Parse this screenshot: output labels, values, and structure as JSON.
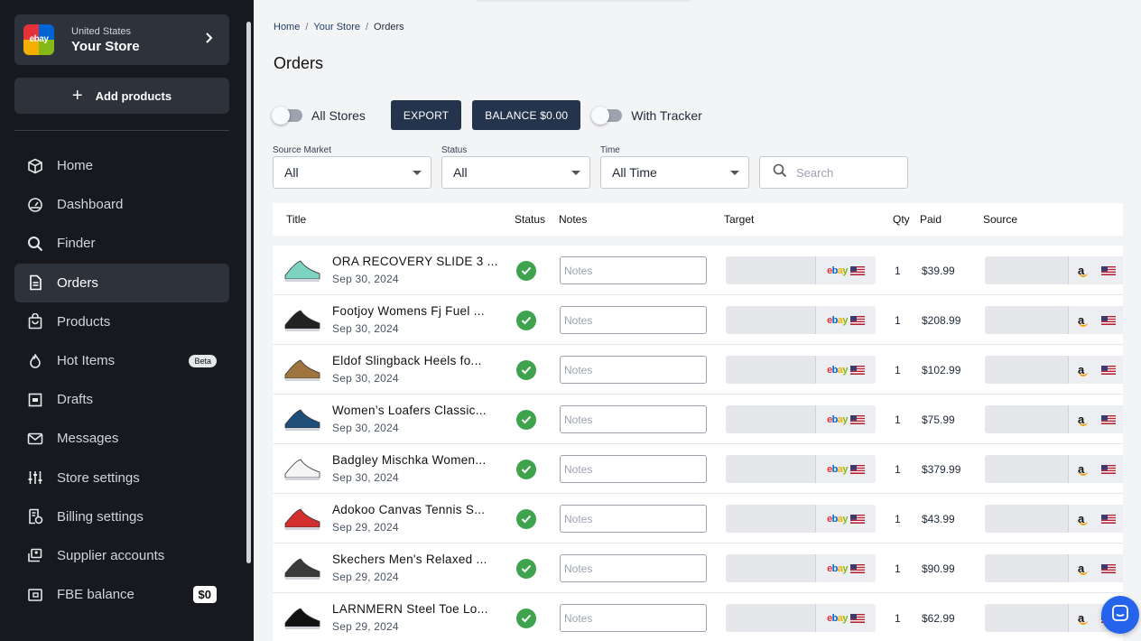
{
  "store": {
    "country": "United States",
    "name": "Your Store",
    "logo_text": "ebay"
  },
  "sidebar": {
    "add_products": "Add products",
    "items": [
      {
        "label": "Home",
        "icon": "cube-icon"
      },
      {
        "label": "Dashboard",
        "icon": "gauge-icon"
      },
      {
        "label": "Finder",
        "icon": "search-icon"
      },
      {
        "label": "Orders",
        "icon": "document-icon",
        "active": true
      },
      {
        "label": "Products",
        "icon": "bag-icon"
      },
      {
        "label": "Hot Items",
        "icon": "flame-icon",
        "badge": "Beta"
      },
      {
        "label": "Drafts",
        "icon": "draft-icon"
      },
      {
        "label": "Messages",
        "icon": "mail-icon"
      },
      {
        "label": "Store settings",
        "icon": "sliders-icon"
      },
      {
        "label": "Billing settings",
        "icon": "billing-icon"
      },
      {
        "label": "Supplier accounts",
        "icon": "supplier-icon"
      },
      {
        "label": "FBE balance",
        "icon": "wallet-icon",
        "badge": "$0"
      }
    ]
  },
  "breadcrumb": {
    "home": "Home",
    "store": "Your Store",
    "current": "Orders"
  },
  "page_title": "Orders",
  "controls": {
    "all_stores": "All Stores",
    "export": "EXPORT",
    "balance": "BALANCE $0.00",
    "with_tracker": "With Tracker"
  },
  "filters": {
    "source_market": {
      "label": "Source Market",
      "value": "All"
    },
    "status": {
      "label": "Status",
      "value": "All"
    },
    "time": {
      "label": "Time",
      "value": "All Time"
    },
    "search_placeholder": "Search"
  },
  "table": {
    "headers": {
      "title": "Title",
      "status": "Status",
      "notes": "Notes",
      "target": "Target",
      "qty": "Qty",
      "paid": "Paid",
      "source": "Source"
    },
    "notes_placeholder": "Notes",
    "rows": [
      {
        "title": "ORA RECOVERY SLIDE 3 ...",
        "date": "Sep 30, 2024",
        "qty": "1",
        "paid": "$39.99",
        "thumb_color": "#7dd3c0"
      },
      {
        "title": "Footjoy Womens Fj Fuel ...",
        "date": "Sep 30, 2024",
        "qty": "1",
        "paid": "$208.99",
        "thumb_color": "#222222"
      },
      {
        "title": "Eldof Slingback Heels fo...",
        "date": "Sep 30, 2024",
        "qty": "1",
        "paid": "$102.99",
        "thumb_color": "#a0743f"
      },
      {
        "title": "Women’s Loafers Classic...",
        "date": "Sep 30, 2024",
        "qty": "1",
        "paid": "$75.99",
        "thumb_color": "#1f4e79"
      },
      {
        "title": "Badgley Mischka Women...",
        "date": "Sep 30, 2024",
        "qty": "1",
        "paid": "$379.99",
        "thumb_color": "#f5f5f5"
      },
      {
        "title": "Adokoo Canvas Tennis S...",
        "date": "Sep 29, 2024",
        "qty": "1",
        "paid": "$43.99",
        "thumb_color": "#d32f2f"
      },
      {
        "title": "Skechers Men's Relaxed ...",
        "date": "Sep 29, 2024",
        "qty": "1",
        "paid": "$90.99",
        "thumb_color": "#3a3a3a"
      },
      {
        "title": "LARNMERN Steel Toe Lo...",
        "date": "Sep 29, 2024",
        "qty": "1",
        "paid": "$62.99",
        "thumb_color": "#111111"
      }
    ]
  },
  "colors": {
    "sidebar_bg": "#17191e",
    "button_dark": "#24344d",
    "status_green": "#3fa34d",
    "chat_blue": "#2563eb"
  }
}
